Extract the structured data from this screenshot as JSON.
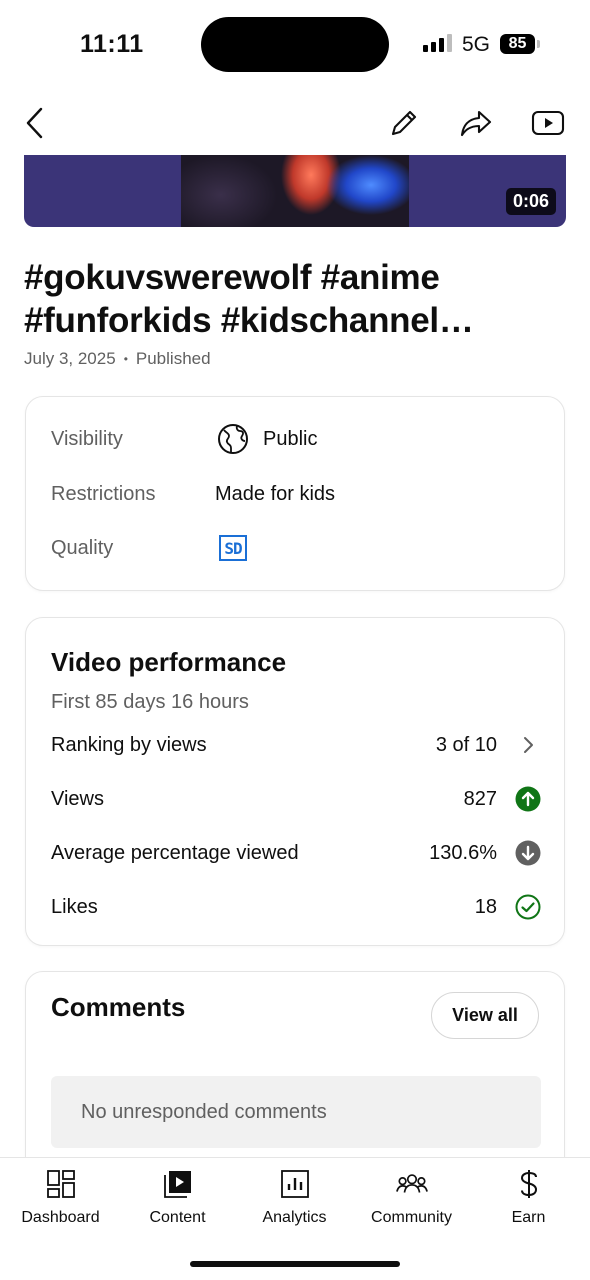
{
  "status_bar": {
    "time": "11:11",
    "network": "5G",
    "battery": "85"
  },
  "video": {
    "duration": "0:06",
    "title": "#gokuvswerewolf #anime #funforkids #kidschannel #kidsvideos #kids #cartoon",
    "date": "July 3, 2025",
    "separator": "•",
    "status": "Published"
  },
  "details": {
    "visibility_label": "Visibility",
    "visibility_value": "Public",
    "restrictions_label": "Restrictions",
    "restrictions_value": "Made for kids",
    "quality_label": "Quality",
    "quality_badge": "SD"
  },
  "performance": {
    "heading": "Video performance",
    "period": "First 85 days 16 hours",
    "rows": [
      {
        "label": "Ranking by views",
        "value": "3 of 10",
        "icon": "chevron-right-icon"
      },
      {
        "label": "Views",
        "value": "827",
        "icon": "arrow-up-circle-icon"
      },
      {
        "label": "Average percentage viewed",
        "value": "130.6%",
        "icon": "arrow-down-circle-icon"
      },
      {
        "label": "Likes",
        "value": "18",
        "icon": "check-circle-icon"
      }
    ],
    "colors": {
      "up": "#107516",
      "down": "#606060",
      "check": "#107516"
    }
  },
  "comments": {
    "heading": "Comments",
    "view_all": "View all",
    "empty": "No unresponded comments"
  },
  "bottom_nav": {
    "tabs": [
      {
        "label": "Dashboard",
        "icon": "dashboard-icon"
      },
      {
        "label": "Content",
        "icon": "content-icon"
      },
      {
        "label": "Analytics",
        "icon": "analytics-icon"
      },
      {
        "label": "Community",
        "icon": "community-icon"
      },
      {
        "label": "Earn",
        "icon": "earn-icon"
      }
    ]
  }
}
